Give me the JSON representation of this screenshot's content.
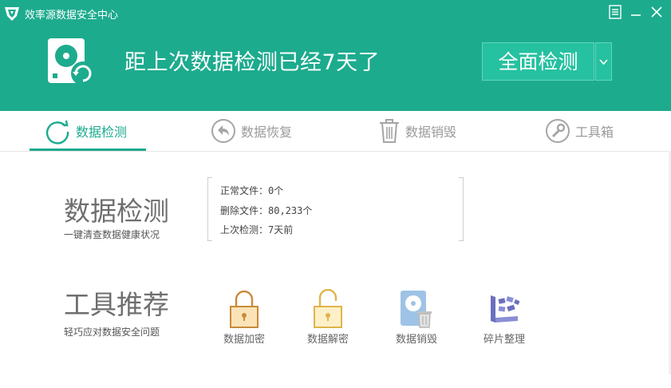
{
  "window": {
    "title": "效率源数据安全中心",
    "icons": [
      "menu-icon",
      "minimize-icon",
      "close-icon"
    ]
  },
  "hero": {
    "message": "距上次数据检测已经7天了",
    "scan_button": "全面检测"
  },
  "tabs": [
    {
      "label": "数据检测",
      "icon": "refresh-circle-icon",
      "active": true
    },
    {
      "label": "数据恢复",
      "icon": "back-arrow-icon",
      "active": false
    },
    {
      "label": "数据销毁",
      "icon": "trash-icon",
      "active": false
    },
    {
      "label": "工具箱",
      "icon": "wrench-icon",
      "active": false
    }
  ],
  "detect": {
    "title": "数据检测",
    "subtitle": "一键清查数据健康状况",
    "info": [
      "正常文件：0个",
      "删除文件：80,233个",
      "上次检测：7天前"
    ]
  },
  "tools": {
    "title": "工具推荐",
    "subtitle": "轻巧应对数据安全问题",
    "items": [
      {
        "label": "数据加密",
        "icon": "lock-icon"
      },
      {
        "label": "数据解密",
        "icon": "unlock-icon"
      },
      {
        "label": "数据销毁",
        "icon": "disk-trash-icon"
      },
      {
        "label": "碎片整理",
        "icon": "defrag-icon"
      }
    ]
  },
  "colors": {
    "accent": "#1dab8e",
    "button": "#26c1a0",
    "lock": "#c88b3a",
    "defrag": "#6b6fc0"
  }
}
